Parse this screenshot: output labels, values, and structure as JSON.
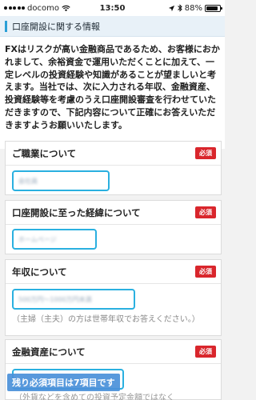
{
  "status_bar": {
    "carrier": "docomo",
    "time": "13:50",
    "battery": "88%",
    "battery_level": 0.88
  },
  "section": {
    "title": "口座開設に関する情報"
  },
  "intro": {
    "text": "FXはリスクが高い金融商品であるため、お客様におかれまして、余裕資金で運用いただくことに加えて、一定レベルの投資経験や知識があることが望ましいと考えます。当社では、次に入力される年収、金融資産、投資経験等を考慮のうえ口座開設審査を行わせていただきますので、下記内容について正確にお答えいただきますようお願いいたします。"
  },
  "fields": {
    "occupation": {
      "label": "ご職業について",
      "required": "必須",
      "value": "会社員"
    },
    "reason": {
      "label": "口座開設に至った経緯について",
      "required": "必須",
      "value": "ホームページ"
    },
    "income": {
      "label": "年収について",
      "required": "必須",
      "value": "500万円～1000万円未満",
      "hint": "（主婦（主夫）の方は世帯年収でお答えください。）"
    },
    "assets": {
      "label": "金融資産について",
      "required": "必須",
      "value": "",
      "hint": "（外貨などを含めての投資予定金額ではなく"
    }
  },
  "notice": {
    "text": "残り必須項目は7項目です"
  }
}
